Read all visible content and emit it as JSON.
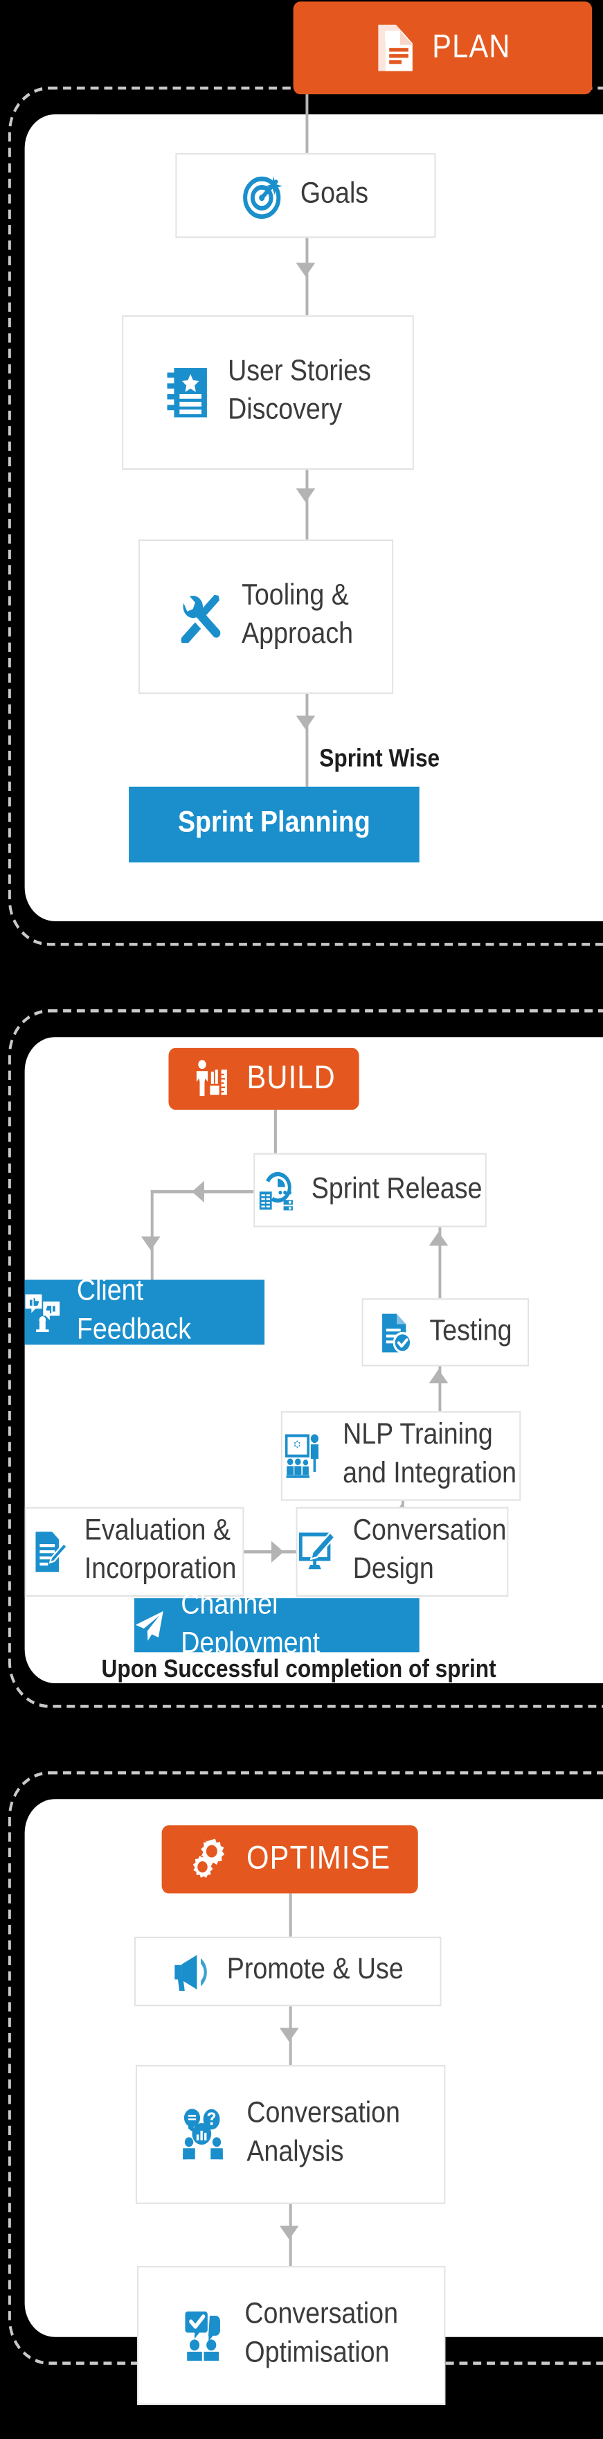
{
  "theme": {
    "orange": "#e4581f",
    "blue": "#1b8fcc",
    "line": "#b3b3b3",
    "text": "#3b3b3b",
    "panel_bg": "#ffffff",
    "backdrop": "#000000",
    "dash": "#c9c9c9"
  },
  "stages": [
    {
      "id": "plan",
      "label": "PLAN",
      "icon": "document-icon"
    },
    {
      "id": "build",
      "label": "BUILD",
      "icon": "builder-ruler-icon"
    },
    {
      "id": "optimise",
      "label": "OPTIMISE",
      "icon": "gears-icon"
    }
  ],
  "plan": {
    "nodes": [
      {
        "id": "goals",
        "label": "Goals",
        "icon": "target-icon"
      },
      {
        "id": "user-stories",
        "label": "User Stories\nDiscovery",
        "icon": "notebook-star-icon"
      },
      {
        "id": "tooling",
        "label": "Tooling &\nApproach",
        "icon": "tools-icon"
      },
      {
        "id": "sprint-planning",
        "label": "Sprint Planning",
        "icon": "none",
        "style": "blue"
      }
    ],
    "caption": "Sprint Wise"
  },
  "build": {
    "nodes": [
      {
        "id": "sprint-release",
        "label": "Sprint Release",
        "icon": "server-deploy-icon"
      },
      {
        "id": "client-feedback",
        "label": "Client Feedback",
        "icon": "thumbs-feedback-icon",
        "style": "blue"
      },
      {
        "id": "testing",
        "label": "Testing",
        "icon": "document-check-icon"
      },
      {
        "id": "nlp-training",
        "label": "NLP Training\nand Integration",
        "icon": "training-board-icon"
      },
      {
        "id": "evaluation",
        "label": "Evaluation &\nIncorporation",
        "icon": "document-pencil-icon"
      },
      {
        "id": "conversation-design",
        "label": "Conversation\nDesign",
        "icon": "monitor-pen-icon"
      },
      {
        "id": "channel-deployment",
        "label": "Channel Deployment",
        "icon": "paper-plane-icon",
        "style": "blue"
      }
    ],
    "caption": "Upon Successful completion of sprint"
  },
  "optimise": {
    "nodes": [
      {
        "id": "promote-use",
        "label": "Promote & Use",
        "icon": "megaphone-icon"
      },
      {
        "id": "conversation-analysis",
        "label": "Conversation\nAnalysis",
        "icon": "chat-analytics-icon"
      },
      {
        "id": "conversation-optimisation",
        "label": "Conversation\nOptimisation",
        "icon": "chat-check-people-icon"
      }
    ]
  }
}
